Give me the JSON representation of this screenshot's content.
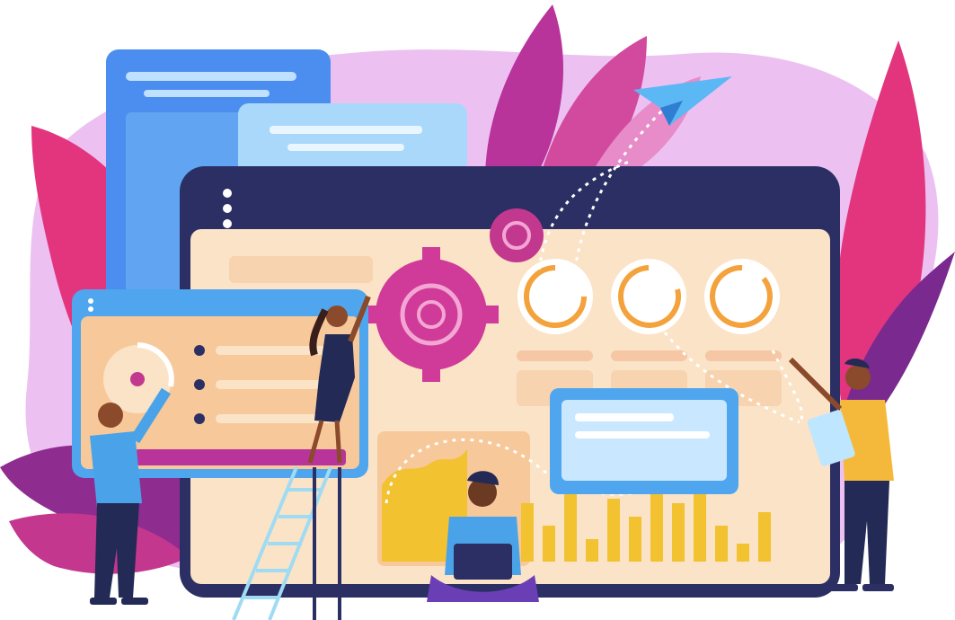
{
  "scene": {
    "kind": "flat vector illustration",
    "colors": {
      "blob": "#e7b6ef",
      "leaf_pink": "#e2357e",
      "leaf_magenta": "#b8339a",
      "leaf_purple": "#7a2a8e",
      "monitor_frame": "#2b2f63",
      "screen_cream": "#fbe3c7",
      "screen_peach": "#f7c89a",
      "panel_blue": "#4fa6ee",
      "panel_light": "#c9e8ff",
      "gear_magenta": "#d03a98",
      "ring_orange": "#f4a23c",
      "bar_gold": "#f2c230",
      "person_blue_shirt": "#4aa3e8",
      "person_dark": "#222a55",
      "plane_blue": "#5bb8f5",
      "ladder": "#9fdcf3"
    },
    "icons": [
      "paper-plane-icon",
      "gear-icon",
      "dots-menu-icon"
    ],
    "people": [
      "man-pointing-left",
      "woman-on-ladder",
      "man-with-laptop",
      "man-with-clipboard"
    ]
  }
}
